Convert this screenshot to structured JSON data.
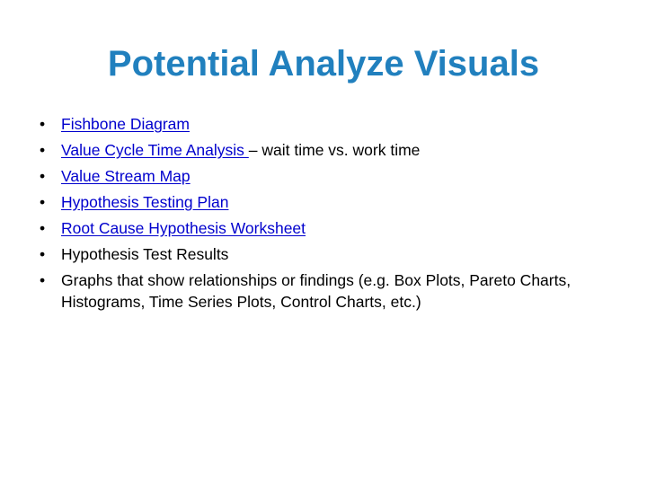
{
  "slide": {
    "title": "Potential Analyze Visuals",
    "title_color": "#2180be",
    "link_color": "#0000cd",
    "text_color": "#000000",
    "background_color": "#ffffff",
    "bullet_glyph": "•",
    "items": [
      {
        "link_label": "Fishbone Diagram",
        "trailing_text": "",
        "is_link": true
      },
      {
        "link_label": "Value Cycle Time Analysis ",
        "trailing_text": "– wait time vs. work time",
        "is_link": true
      },
      {
        "link_label": "Value Stream Map",
        "trailing_text": "",
        "is_link": true
      },
      {
        "link_label": "Hypothesis Testing Plan",
        "trailing_text": "",
        "is_link": true
      },
      {
        "link_label": "Root Cause Hypothesis Worksheet",
        "trailing_text": "",
        "is_link": true
      },
      {
        "link_label": "",
        "trailing_text": "Hypothesis Test Results",
        "is_link": false
      },
      {
        "link_label": "",
        "trailing_text": "Graphs that show relationships or findings (e.g. Box Plots, Pareto Charts, Histograms, Time Series Plots, Control Charts, etc.)",
        "is_link": false
      }
    ]
  }
}
